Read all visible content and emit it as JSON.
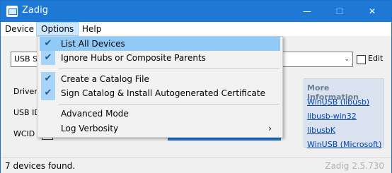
{
  "window": {
    "title": "Zadig",
    "minimize_glyph": "—",
    "maximize_glyph": "☐",
    "close_glyph": "✕"
  },
  "menubar": {
    "device": "Device",
    "options": "Options",
    "help": "Help"
  },
  "device_select": {
    "value": "USB Se",
    "arrow": "⌄"
  },
  "edit": {
    "label": "Edit"
  },
  "labels": {
    "driver": "Driver",
    "usb_id": "USB ID",
    "wcid": "WCID"
  },
  "info": {
    "heading": "More Information",
    "links": [
      "WinUSB (libusb)",
      "libusb-win32",
      "libusbK",
      "WinUSB (Microsoft)"
    ]
  },
  "options_menu": {
    "items": [
      {
        "label": "List All Devices",
        "checked": true
      },
      {
        "label": "Ignore Hubs or Composite Parents",
        "checked": true
      },
      {
        "label": "Create a Catalog File",
        "checked": true
      },
      {
        "label": "Sign Catalog & Install Autogenerated Certificate",
        "checked": true
      },
      {
        "label": "Advanced Mode",
        "checked": false
      },
      {
        "label": "Log Verbosity",
        "checked": false,
        "submenu": "›"
      }
    ]
  },
  "status": {
    "message": "7 devices found.",
    "version": "Zadig 2.5.730"
  },
  "colors": {
    "titlebar": "#1e78d6",
    "highlight": "#91c9f7",
    "check_bg": "#a8d4f8"
  }
}
